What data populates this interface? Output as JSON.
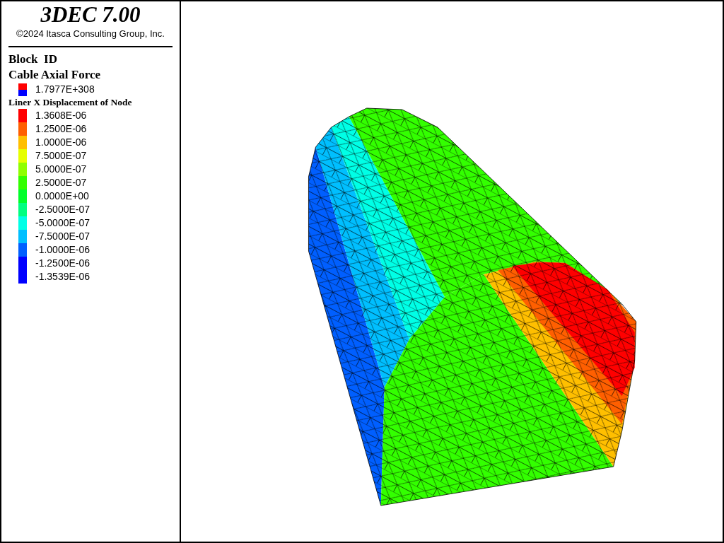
{
  "title": "3DEC 7.00",
  "copyright": "©2024 Itasca Consulting Group, Inc.",
  "legend": {
    "block_label": "Block  ID",
    "cable": {
      "title": "Cable Axial Force",
      "value": "1.7977E+308",
      "swatches": [
        {
          "color": "#ff0000"
        },
        {
          "color": "#0000ff"
        }
      ]
    },
    "liner": {
      "title": "Liner X Displacement of Node",
      "items": [
        {
          "label": "1.3608E-06",
          "color": "#ff0000"
        },
        {
          "label": "1.2500E-06",
          "color": "#ff5f00"
        },
        {
          "label": "1.0000E-06",
          "color": "#ffbf00"
        },
        {
          "label": "7.5000E-07",
          "color": "#e6ff00"
        },
        {
          "label": "5.0000E-07",
          "color": "#8fff00"
        },
        {
          "label": "2.5000E-07",
          "color": "#33ff00"
        },
        {
          "label": "0.0000E+00",
          "color": "#00ff2a"
        },
        {
          "label": "-2.5000E-07",
          "color": "#00ff80"
        },
        {
          "label": "-5.0000E-07",
          "color": "#00ffe6"
        },
        {
          "label": "-7.5000E-07",
          "color": "#00bfff"
        },
        {
          "label": "-1.0000E-06",
          "color": "#005fff"
        },
        {
          "label": "-1.2500E-06",
          "color": "#0000ff"
        },
        {
          "label": "-1.3539E-06",
          "color": "#0000ff"
        }
      ]
    }
  }
}
